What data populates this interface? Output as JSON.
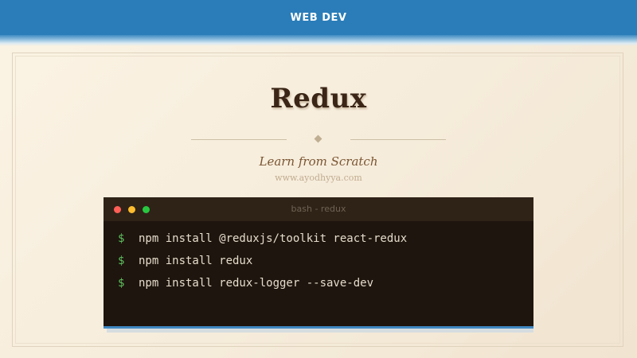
{
  "header": {
    "category": "WEB DEV"
  },
  "hero": {
    "title": "Redux",
    "subtitle": "Learn from Scratch",
    "website": "www.ayodhyya.com"
  },
  "terminal": {
    "title": "bash - redux",
    "prompt": "$",
    "commands": [
      "npm install @reduxjs/toolkit react-redux",
      "npm install redux",
      "npm install redux-logger --save-dev"
    ]
  },
  "colors": {
    "header_bar": "#2a7db8",
    "background": "#f6ecdb",
    "title": "#3a2516",
    "subtitle": "#7a5533",
    "terminal_bg": "#1e150e",
    "prompt": "#5ec05e",
    "window_close": "#ff5f57",
    "window_minimize": "#febc2e",
    "window_maximize": "#28c840"
  }
}
